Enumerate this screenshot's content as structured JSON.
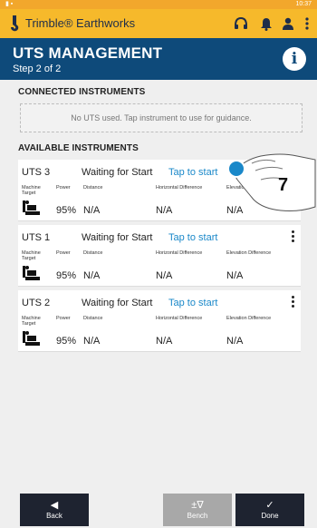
{
  "status_bar": {
    "time": "10:37"
  },
  "app_bar": {
    "brand": "Trimble® Earthworks",
    "icons": [
      "headset-icon",
      "bell-icon",
      "user-icon",
      "more-vertical-icon"
    ]
  },
  "header": {
    "title": "UTS MANAGEMENT",
    "step": "Step 2 of 2",
    "info_glyph": "i"
  },
  "connected": {
    "label": "CONNECTED INSTRUMENTS",
    "guidance": "No UTS used. Tap instrument to use for guidance."
  },
  "available": {
    "label": "AVAILABLE INSTRUMENTS",
    "instruments": [
      {
        "name": "UTS 3",
        "status": "Waiting for Start",
        "action": "Tap to start",
        "labels": {
          "machine_target": "Machine Target",
          "power": "Power",
          "distance": "Distance",
          "horizontal": "Horizontal Difference",
          "elevation": "Elevation Difference"
        },
        "power": "95%",
        "distance": "N/A",
        "horizontal": "N/A",
        "elevation": "N/A"
      },
      {
        "name": "UTS 1",
        "status": "Waiting for Start",
        "action": "Tap to start",
        "labels": {
          "machine_target": "Machine Target",
          "power": "Power",
          "distance": "Distance",
          "horizontal": "Horizontal Difference",
          "elevation": "Elevation Difference"
        },
        "power": "95%",
        "distance": "N/A",
        "horizontal": "N/A",
        "elevation": "N/A"
      },
      {
        "name": "UTS 2",
        "status": "Waiting for Start",
        "action": "Tap to start",
        "labels": {
          "machine_target": "Machine Target",
          "power": "Power",
          "distance": "Distance",
          "horizontal": "Horizontal Difference",
          "elevation": "Elevation Difference"
        },
        "power": "95%",
        "distance": "N/A",
        "horizontal": "N/A",
        "elevation": "N/A"
      }
    ]
  },
  "callout": {
    "number": "7"
  },
  "footer": {
    "back": {
      "label": "Back",
      "glyph": "◀"
    },
    "bench": {
      "label": "Bench",
      "glyph": "±∇"
    },
    "done": {
      "label": "Done",
      "glyph": "✓"
    }
  },
  "colors": {
    "app_bar": "#f6b92b",
    "header": "#0e4a7a",
    "link": "#1a88c9",
    "footer_button": "#1e2330",
    "footer_button_disabled": "#a8a8a8"
  }
}
